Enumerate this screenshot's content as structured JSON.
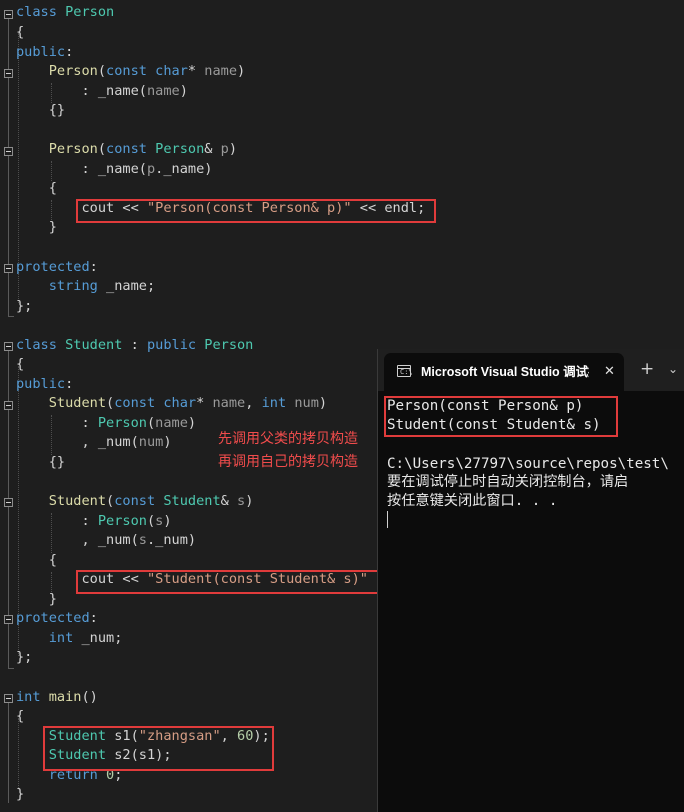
{
  "editor": {
    "lines": {
      "l0": [
        "class",
        " ",
        "Person"
      ],
      "l1": [
        "{"
      ],
      "l2": [
        "public",
        ":"
      ],
      "l3": [
        "    ",
        "Person",
        "(",
        "const",
        " ",
        "char",
        "* ",
        "name",
        ")"
      ],
      "l4": [
        "        : ",
        "_name",
        "(",
        "name",
        ")"
      ],
      "l5": [
        "    {}"
      ],
      "l6": [
        "    ",
        "Person",
        "(",
        "const",
        " ",
        "Person",
        "& ",
        "p",
        ")"
      ],
      "l7": [
        "        : ",
        "_name",
        "(",
        "p",
        ".",
        "_name",
        ")"
      ],
      "l8": [
        "    {"
      ],
      "l9": [
        "        ",
        "cout",
        " << ",
        "\"Person(const Person& p)\"",
        " << ",
        "endl",
        ";"
      ],
      "l10": [
        "    }"
      ],
      "l11": [
        "protected",
        ":"
      ],
      "l12": [
        "    ",
        "string",
        " ",
        "_name",
        ";"
      ],
      "l13": [
        "};"
      ],
      "l14": [
        "class",
        " ",
        "Student",
        " : ",
        "public",
        " ",
        "Person"
      ],
      "l15": [
        "{"
      ],
      "l16": [
        "public",
        ":"
      ],
      "l17": [
        "    ",
        "Student",
        "(",
        "const",
        " ",
        "char",
        "* ",
        "name",
        ", ",
        "int",
        " ",
        "num",
        ")"
      ],
      "l18": [
        "        : ",
        "Person",
        "(",
        "name",
        ")"
      ],
      "l19": [
        "        , ",
        "_num",
        "(",
        "num",
        ")"
      ],
      "l20": [
        "    {}"
      ],
      "l21": [
        "    ",
        "Student",
        "(",
        "const",
        " ",
        "Student",
        "& ",
        "s",
        ")"
      ],
      "l22": [
        "        : ",
        "Person",
        "(",
        "s",
        ")"
      ],
      "l23": [
        "        , ",
        "_num",
        "(",
        "s",
        ".",
        "_num",
        ")"
      ],
      "l24": [
        "    {"
      ],
      "l25": [
        "        ",
        "cout",
        " << ",
        "\"Student(const Student& s)\""
      ],
      "l26": [
        "    }"
      ],
      "l27": [
        "protected",
        ":"
      ],
      "l28": [
        "    ",
        "int",
        " ",
        "_num",
        ";"
      ],
      "l29": [
        "};"
      ],
      "l30": [
        "int",
        " ",
        "main",
        "()"
      ],
      "l31": [
        "{"
      ],
      "l32": [
        "    ",
        "Student",
        " ",
        "s1",
        "(",
        "\"zhangsan\"",
        ", ",
        "60",
        ");"
      ],
      "l33": [
        "    ",
        "Student",
        " ",
        "s2",
        "(",
        "s1",
        ");"
      ],
      "l34": [
        "    ",
        "return",
        " ",
        "0",
        ";"
      ],
      "l35": [
        "}"
      ]
    },
    "annotation": {
      "line1": "先调用父类的拷贝构造",
      "line2": "再调用自己的拷贝构造"
    }
  },
  "terminal": {
    "tab_title": "Microsoft Visual Studio 调试控制台",
    "tab_icon": "C:\\",
    "icons": {
      "tab": "console-icon",
      "close": "close-icon",
      "new_tab": "plus-icon",
      "dropdown": "chevron-down-icon"
    },
    "close_glyph": "✕",
    "new_tab_glyph": "+",
    "dropdown_glyph": "⌄",
    "output": [
      "Person(const Person& p)",
      "Student(const Student& s)",
      "",
      "C:\\Users\\27797\\source\\repos\\test\\",
      "要在调试停止时自动关闭控制台，请启",
      "按任意键关闭此窗口. . ."
    ]
  },
  "colors": {
    "background": "#1e1e1e",
    "keyword": "#569cd6",
    "type": "#4ec9b0",
    "string": "#d69d85",
    "number": "#b5cea8",
    "highlight_box": "#e03b3b",
    "annotation": "#f14c4c",
    "terminal_background": "#0c0c0c"
  }
}
